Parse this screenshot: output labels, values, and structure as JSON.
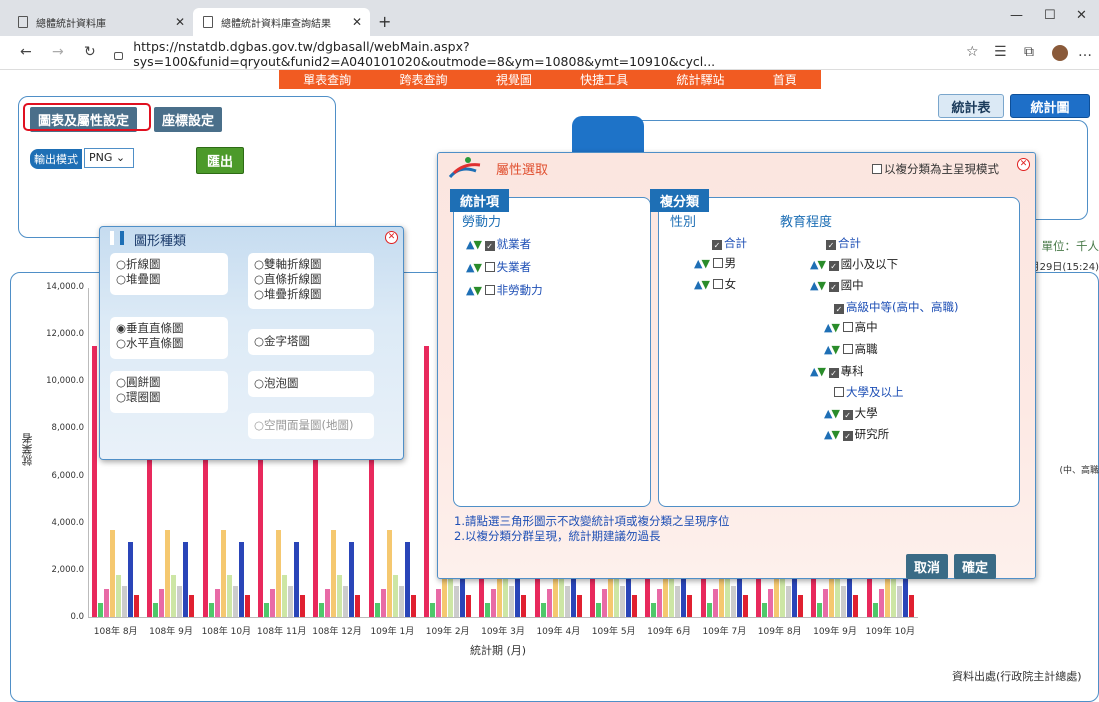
{
  "browser": {
    "tabs": [
      {
        "title": "總體統計資料庫"
      },
      {
        "title": "總體統計資料庫查詢結果"
      }
    ],
    "new_tab": "+",
    "url": "https://nstatdb.dgbas.gov.tw/dgbasall/webMain.aspx?sys=100&funid=qryout&funid2=A040101020&outmode=8&ym=10808&ymt=10910&cycl..."
  },
  "menu": [
    "單表查詢",
    "跨表查詢",
    "視覺圖",
    "快捷工具",
    "統計驛站",
    "首頁"
  ],
  "settings": {
    "tab_chart_attr": "圖表及屬性設定",
    "tab_axis": "座標設定",
    "output_mode_label": "輸出模式",
    "output_mode_value": "PNG",
    "export_button": "匯出"
  },
  "view_buttons": {
    "table": "統計表",
    "chart": "統計圖"
  },
  "unit_text": "單位：千人",
  "update_text": "月29日(15:24)",
  "legend_fragment": "中、高職)",
  "source_text": "資料出處(行政院主計總處)",
  "chart_type_dialog": {
    "title": "圖形種類",
    "groups": [
      [
        "○折線圖",
        "○堆疊圖"
      ],
      [
        "○雙軸折線圖",
        "○直條折線圖",
        "○堆疊折線圖"
      ],
      [
        "◉垂直直條圖",
        "○水平直條圖"
      ],
      [
        "○金字塔圖"
      ],
      [
        "○圓餅圖",
        "○環圈圖"
      ],
      [
        "○泡泡圖"
      ],
      [
        "○空間面量圖(地圖)"
      ]
    ]
  },
  "attr_dialog": {
    "title": "屬性選取",
    "multi_mode": "以複分類為主呈現模式",
    "stat_header": "統計項",
    "stat_group": "勞動力",
    "stat_items": [
      {
        "label": "就業者",
        "checked": true
      },
      {
        "label": "失業者",
        "checked": false
      },
      {
        "label": "非勞動力",
        "checked": false
      }
    ],
    "class_header": "複分類",
    "gender_title": "性別",
    "gender_items": [
      {
        "label": "合計",
        "checked": true
      },
      {
        "label": "男",
        "checked": false
      },
      {
        "label": "女",
        "checked": false
      }
    ],
    "edu_title": "教育程度",
    "edu_items": [
      {
        "label": "合計",
        "checked": true
      },
      {
        "label": "國小及以下",
        "checked": true
      },
      {
        "label": "國中",
        "checked": true
      },
      {
        "label": "高級中等(高中、高職)",
        "checked": true
      },
      {
        "label": "高中",
        "checked": false
      },
      {
        "label": "高職",
        "checked": false
      },
      {
        "label": "專科",
        "checked": true
      },
      {
        "label": "大學及以上",
        "checked": false
      },
      {
        "label": "大學",
        "checked": true
      },
      {
        "label": "研究所",
        "checked": true
      }
    ],
    "note1": "1.請點選三角形圖示不改變統計項或複分類之呈現序位",
    "note2": "2.以複分類分群呈現，統計期建議勿過長",
    "cancel": "取消",
    "confirm": "確定"
  },
  "chart_data": {
    "type": "bar",
    "ylabel": "就業者",
    "xlabel": "統計期 (月)",
    "ylim": [
      0,
      14000
    ],
    "yticks": [
      "14,000.0",
      "12,000.0",
      "10,000.0",
      "8,000.0",
      "6,000.0",
      "4,000.0",
      "2,000.0",
      "0.0"
    ],
    "categories": [
      "108年 8月",
      "108年 9月",
      "108年 10月",
      "108年 11月",
      "108年 12月",
      "109年 1月",
      "109年 2月",
      "109年 3月",
      "109年 4月",
      "109年 5月",
      "109年 6月",
      "109年 7月",
      "109年 8月",
      "109年 9月",
      "109年 10月"
    ],
    "series": [
      {
        "color": "#e8295c",
        "values": [
          11500,
          11500,
          11500,
          11500,
          11500,
          11500,
          11500,
          11500,
          11500,
          11500,
          11500,
          11500,
          11500,
          11500,
          11500
        ]
      },
      {
        "color": "#4fc86a",
        "values": [
          600,
          600,
          600,
          600,
          600,
          600,
          600,
          600,
          600,
          600,
          600,
          600,
          600,
          600,
          600
        ]
      },
      {
        "color": "#e86aa6",
        "values": [
          1200,
          1200,
          1200,
          1200,
          1200,
          1200,
          1200,
          1200,
          1200,
          1200,
          1200,
          1200,
          1200,
          1200,
          1200
        ]
      },
      {
        "color": "#f5c870",
        "values": [
          3700,
          3700,
          3700,
          3700,
          3700,
          3700,
          3700,
          3700,
          3700,
          3700,
          3700,
          3700,
          3700,
          3700,
          3700
        ]
      },
      {
        "color": "#cde6a5",
        "values": [
          1800,
          1800,
          1800,
          1800,
          1800,
          1800,
          1800,
          1800,
          1800,
          1800,
          1800,
          1800,
          1800,
          1800,
          1800
        ]
      },
      {
        "color": "#cccccc",
        "values": [
          1300,
          1300,
          1300,
          1300,
          1300,
          1300,
          1300,
          1300,
          1300,
          1300,
          1300,
          1300,
          1300,
          1300,
          1300
        ]
      },
      {
        "color": "#2a45b8",
        "values": [
          3200,
          3200,
          3200,
          3200,
          3200,
          3200,
          3200,
          3200,
          3200,
          3200,
          3200,
          3200,
          3200,
          3200,
          3200
        ]
      },
      {
        "color": "#e02030",
        "values": [
          950,
          950,
          950,
          950,
          950,
          950,
          950,
          950,
          950,
          950,
          950,
          950,
          950,
          950,
          950
        ]
      }
    ]
  }
}
